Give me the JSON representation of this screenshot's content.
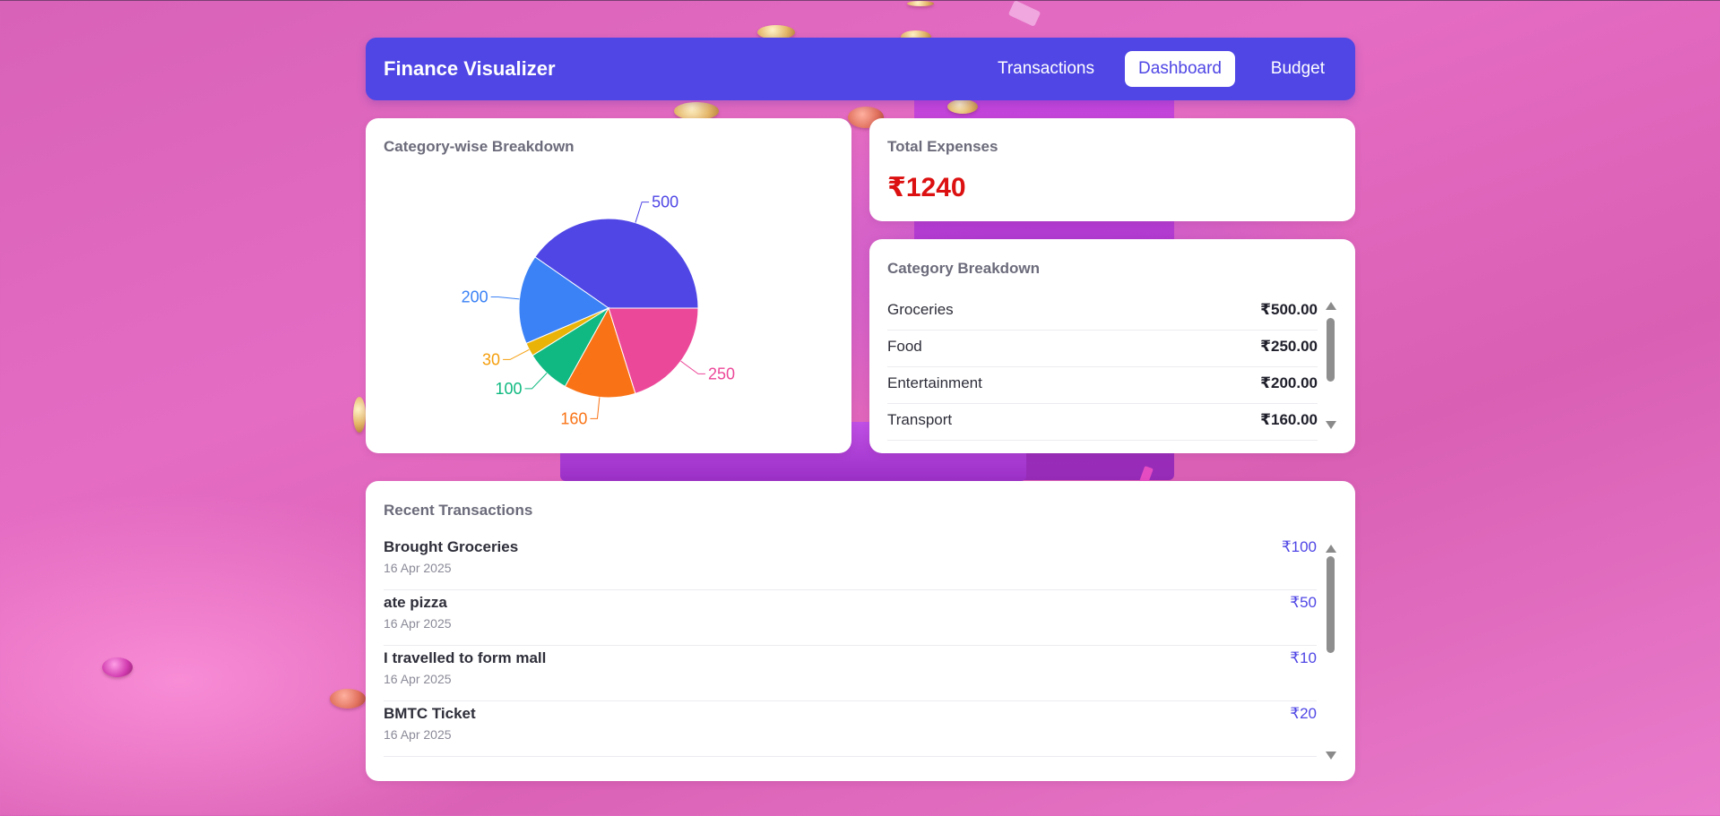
{
  "app": {
    "title": "Finance Visualizer"
  },
  "nav": {
    "items": [
      {
        "label": "Transactions",
        "active": false
      },
      {
        "label": "Dashboard",
        "active": true
      },
      {
        "label": "Budget",
        "active": false
      }
    ]
  },
  "pie_card": {
    "title": "Category-wise Breakdown"
  },
  "chart_data": {
    "type": "pie",
    "title": "Category-wise Breakdown",
    "slices": [
      {
        "value": 500,
        "label": "500",
        "color": "#4f46e5"
      },
      {
        "value": 200,
        "label": "200",
        "color": "#3b82f6"
      },
      {
        "value": 30,
        "label": "30",
        "color": "#eab308"
      },
      {
        "value": 100,
        "label": "100",
        "color": "#10b981"
      },
      {
        "value": 160,
        "label": "160",
        "color": "#f97316"
      },
      {
        "value": 250,
        "label": "250",
        "color": "#ec4899"
      }
    ],
    "label_colors": [
      "#4f46e5",
      "#3b82f6",
      "#f59e0b",
      "#10b981",
      "#f97316",
      "#ec4899"
    ]
  },
  "total": {
    "title": "Total Expenses",
    "value": "₹1240",
    "color": "#dc1010"
  },
  "categories": {
    "title": "Category Breakdown",
    "items": [
      {
        "name": "Groceries",
        "amount": "₹500.00"
      },
      {
        "name": "Food",
        "amount": "₹250.00"
      },
      {
        "name": "Entertainment",
        "amount": "₹200.00"
      },
      {
        "name": "Transport",
        "amount": "₹160.00"
      }
    ]
  },
  "transactions": {
    "title": "Recent Transactions",
    "items": [
      {
        "description": "Brought Groceries",
        "date": "16 Apr 2025",
        "amount": "₹100"
      },
      {
        "description": "ate pizza",
        "date": "16 Apr 2025",
        "amount": "₹50"
      },
      {
        "description": "I travelled to form mall",
        "date": "16 Apr 2025",
        "amount": "₹10"
      },
      {
        "description": "BMTC Ticket",
        "date": "16 Apr 2025",
        "amount": "₹20"
      }
    ]
  },
  "colors": {
    "accent": "#4f46e5",
    "expense": "#dc1010"
  }
}
